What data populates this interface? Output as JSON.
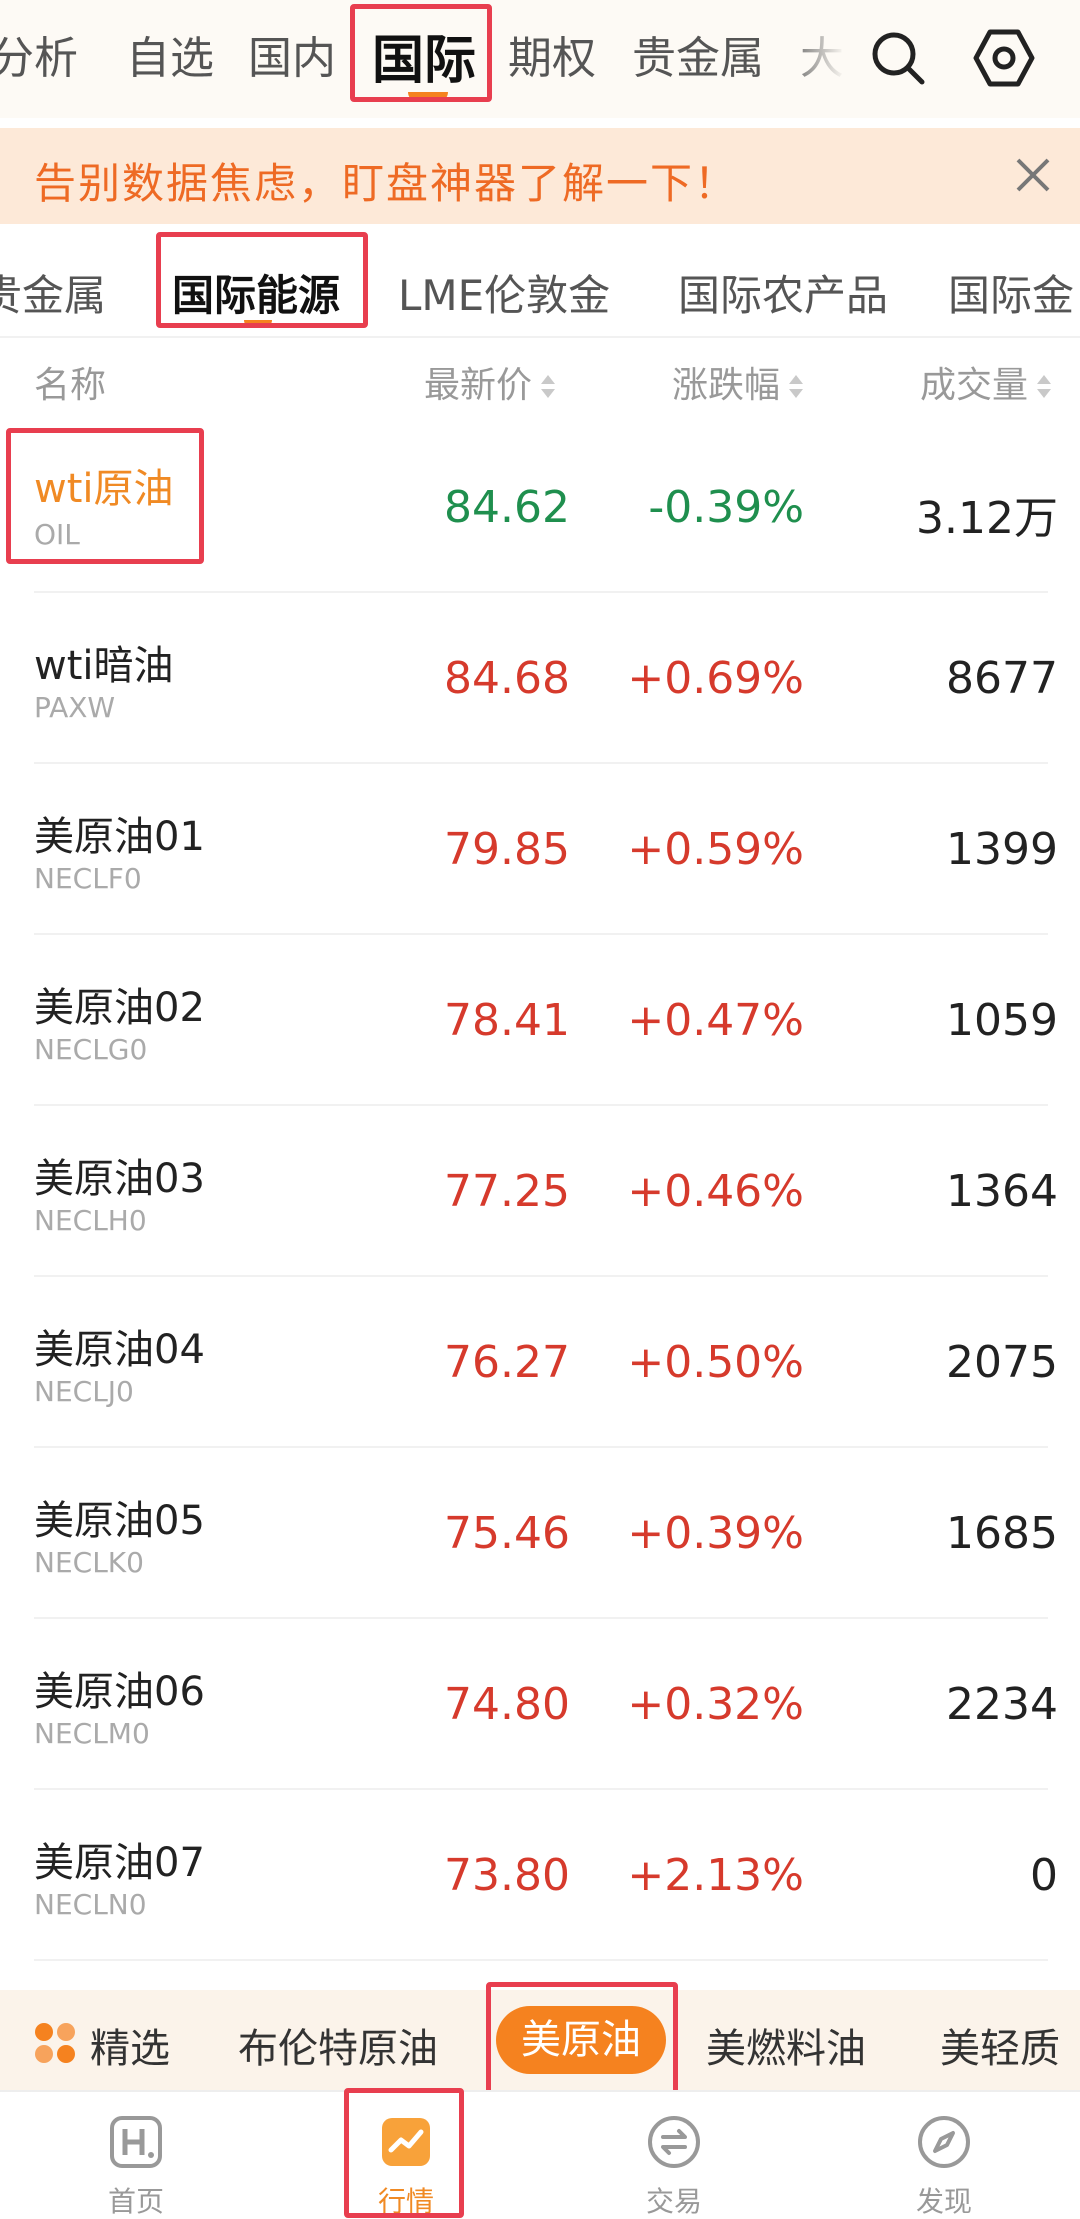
{
  "top_nav": {
    "tabs": [
      "分析",
      "自选",
      "国内",
      "国际",
      "期权",
      "贵金属",
      "大"
    ],
    "active": "国际"
  },
  "banner": {
    "text": "告别数据焦虑，盯盘神器了解一下！"
  },
  "category_tabs": {
    "items": [
      "贵金属",
      "国际能源",
      "LME伦敦金",
      "国际农产品",
      "国际金"
    ],
    "active": "国际能源"
  },
  "table": {
    "headers": {
      "name": "名称",
      "price": "最新价",
      "change": "涨跌幅",
      "volume": "成交量"
    },
    "rows": [
      {
        "name": "wti原油",
        "code": "OIL",
        "price": "84.62",
        "change": "-0.39%",
        "volume": "3.12万",
        "direction": "down"
      },
      {
        "name": "wti暗油",
        "code": "PAXW",
        "price": "84.68",
        "change": "+0.69%",
        "volume": "8677",
        "direction": "up"
      },
      {
        "name": "美原油01",
        "code": "NECLF0",
        "price": "79.85",
        "change": "+0.59%",
        "volume": "1399",
        "direction": "up"
      },
      {
        "name": "美原油02",
        "code": "NECLG0",
        "price": "78.41",
        "change": "+0.47%",
        "volume": "1059",
        "direction": "up"
      },
      {
        "name": "美原油03",
        "code": "NECLH0",
        "price": "77.25",
        "change": "+0.46%",
        "volume": "1364",
        "direction": "up"
      },
      {
        "name": "美原油04",
        "code": "NECLJ0",
        "price": "76.27",
        "change": "+0.50%",
        "volume": "2075",
        "direction": "up"
      },
      {
        "name": "美原油05",
        "code": "NECLK0",
        "price": "75.46",
        "change": "+0.39%",
        "volume": "1685",
        "direction": "up"
      },
      {
        "name": "美原油06",
        "code": "NECLM0",
        "price": "74.80",
        "change": "+0.32%",
        "volume": "2234",
        "direction": "up"
      },
      {
        "name": "美原油07",
        "code": "NECLN0",
        "price": "73.80",
        "change": "+2.13%",
        "volume": "0",
        "direction": "up"
      }
    ]
  },
  "sub_bar": {
    "featured": "精选",
    "items": [
      "布伦特原油",
      "美原油",
      "美燃料油",
      "美轻质"
    ],
    "active": "美原油"
  },
  "bottom_nav": {
    "items": [
      {
        "label": "首页",
        "icon": "home-h-icon"
      },
      {
        "label": "行情",
        "icon": "market-chart-icon"
      },
      {
        "label": "交易",
        "icon": "trade-exchange-icon"
      },
      {
        "label": "发现",
        "icon": "discover-compass-icon"
      }
    ],
    "active": "行情"
  },
  "colors": {
    "accent": "#f5821f",
    "up": "#d63a2c",
    "down": "#1f8f4e",
    "highlight_box": "#e83e4f",
    "banner_bg": "#fde9d8"
  },
  "icons": [
    "search-icon",
    "settings-icon",
    "close-icon",
    "sort-icon",
    "grid-dots-icon"
  ]
}
